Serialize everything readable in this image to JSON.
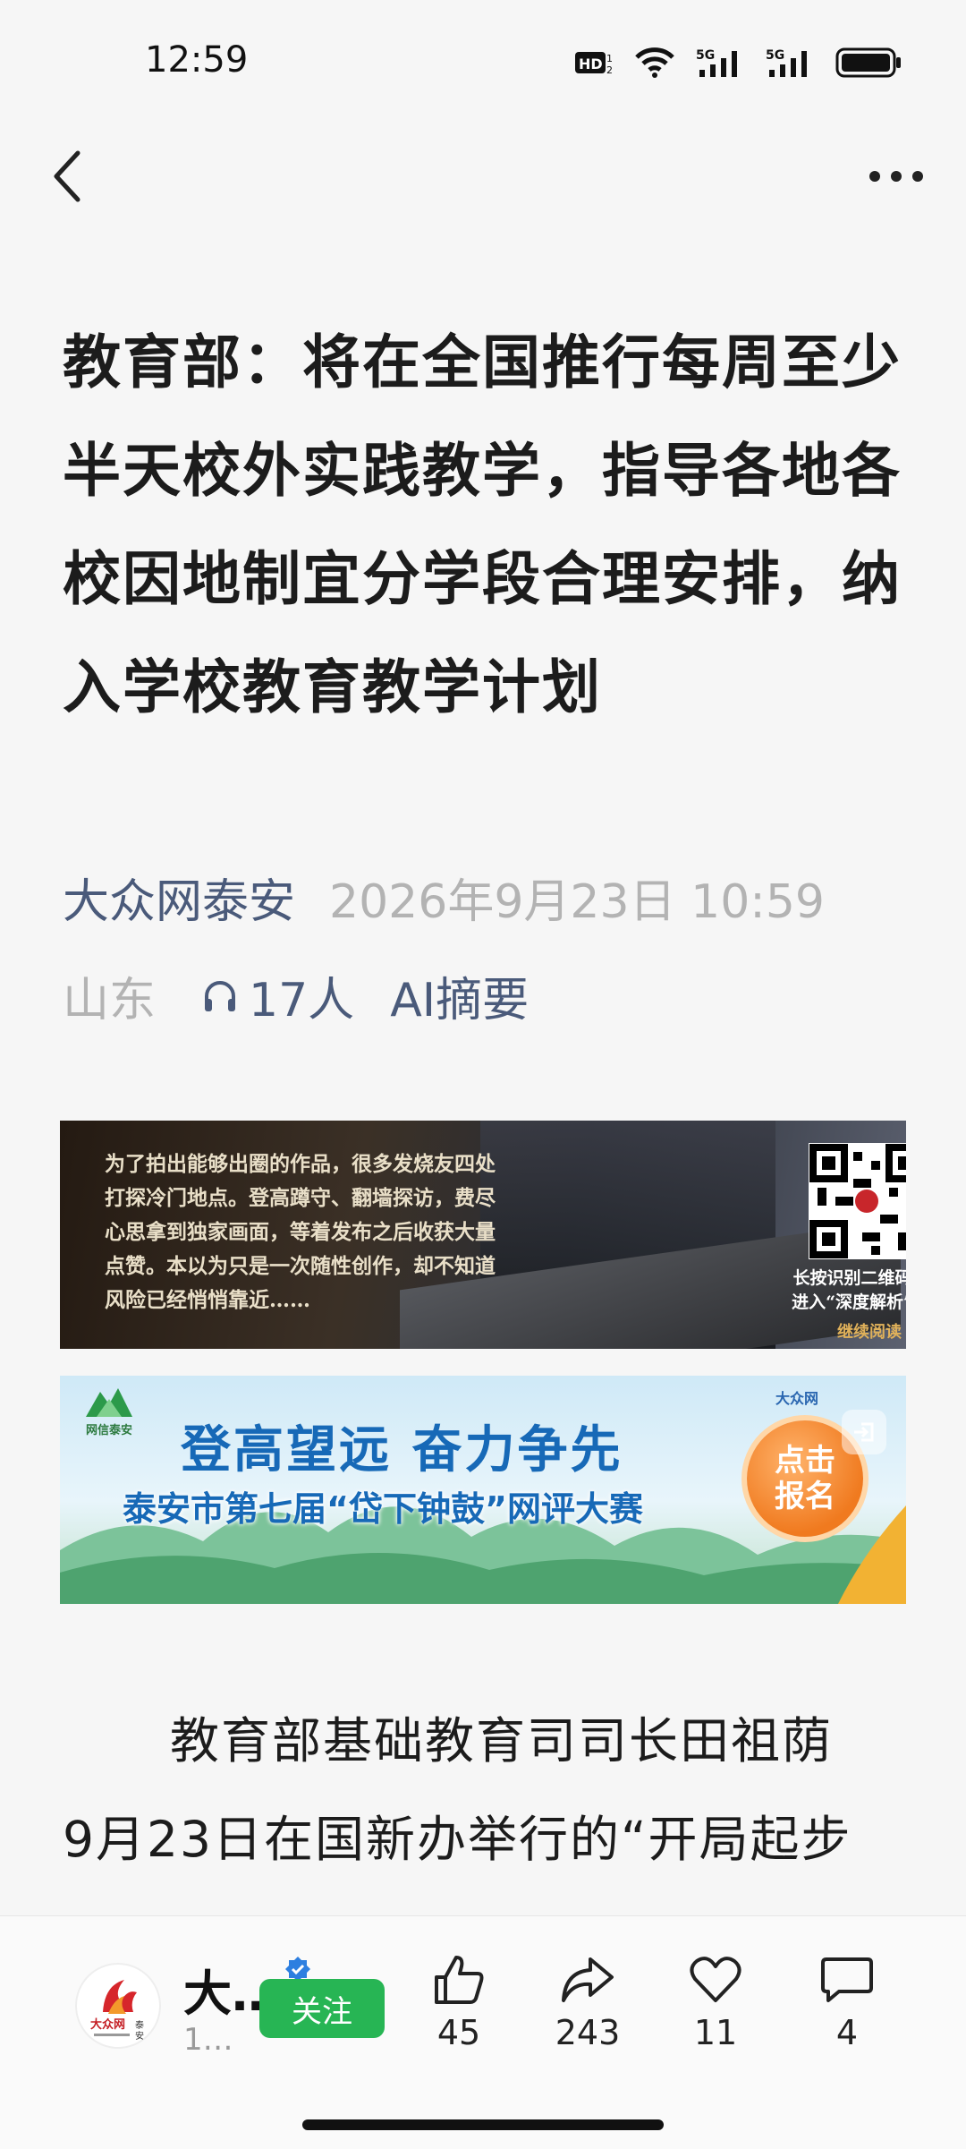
{
  "status_bar": {
    "time": "12:59",
    "icons": [
      "hd-icon",
      "wifi-icon",
      "5g-signal-icon",
      "5g-signal-icon",
      "battery-icon"
    ]
  },
  "nav": {
    "back_icon": "chevron-left-icon",
    "more_icon": "more-dots-icon"
  },
  "article": {
    "title": "教育部：将在全国推行每周至少半天校外实践教学，指导各地各校因地制宜分学段合理安排，纳入学校教育教学计划",
    "source": "大众网泰安",
    "datetime": "2026年9月23日 10:59",
    "region": "山东",
    "listeners": "17人",
    "ai_summary": "AI摘要",
    "body_lines": [
      "教育部基础教育司司长田祖荫",
      "9月23日在国新办举行的“开局起步"
    ]
  },
  "banner1": {
    "text": "为了拍出能够出圈的作品，很多发烧友四处打探冷门地点。登高蹲守、翻墙探访，费尽心思拿到独家画面，等着发布之后收获大量点赞。本以为只是一次随性创作，却不知道风险已经悄悄靠近……",
    "qr_caption_line1": "长按识别二维码关注",
    "qr_caption_line2": "进入“深度解析”栏目",
    "continue_label": "继续阅读"
  },
  "banner2": {
    "logo_text": "网信泰安",
    "slogan": "登高望远  奋力争先",
    "contest": "泰安市第七届“岱下钟鼓”网评大赛",
    "signup": "点击报名",
    "brand": "大众网"
  },
  "bottom_bar": {
    "author_name": "大…",
    "author_sub": "1…",
    "follow_label": "关注",
    "like_count": "45",
    "share_count": "243",
    "favorite_count": "11",
    "comment_count": "4"
  },
  "colors": {
    "accent_blue": "#4a5a7a",
    "follow_green": "#27b554",
    "muted_gray": "#b3b3b3"
  }
}
